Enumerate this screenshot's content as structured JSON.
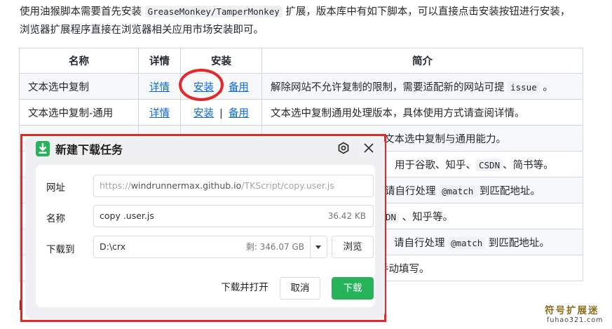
{
  "intro": {
    "text_a": "使用油猴脚本需要首先安装 ",
    "code": "GreaseMonkey/TamperMonkey",
    "text_b": " 扩展，版本库中有如下脚本，可以直接点击安装按钮进行安装，",
    "text_c": "浏览器扩展程序直接在浏览器相关应用市场安装即可。"
  },
  "table": {
    "headers": [
      "名称",
      "详情",
      "安装",
      "简介"
    ],
    "rows": [
      {
        "name": "文本选中复制",
        "detail": "详情",
        "install": "安装",
        "sep": "|",
        "backup": "备用",
        "desc_a": "解除网站不允许复制的限制，需要适配新的网站可提 ",
        "desc_code": "issue",
        "desc_b": " 。"
      },
      {
        "name": "文本选中复制-通用",
        "detail": "详情",
        "install": "安装",
        "sep": "|",
        "backup": "备用",
        "desc_a": "文本选中复制通用处理版本，具体使用方式请查阅详情。",
        "desc_code": "",
        "desc_b": ""
      },
      {
        "desc_a": "文本选中复制与通用能力。",
        "desc_code": "",
        "desc_b": ""
      },
      {
        "desc_a": "用于谷歌、知乎、",
        "desc_code": "CSDN",
        "desc_b": "、简书等。"
      },
      {
        "desc_a": "请自行处理 ",
        "desc_code": "@match",
        "desc_b": " 到匹配地址。"
      },
      {
        "desc_a": "",
        "desc_code": "DN",
        "desc_b": " 、知乎等。"
      },
      {
        "desc_a": "请自行处理 ",
        "desc_code": "@match",
        "desc_b": " 到匹配地址。"
      },
      {
        "desc_a": "手动填写。",
        "desc_code": "",
        "desc_b": ""
      }
    ]
  },
  "dialog": {
    "title": "新建下载任务",
    "url_label": "网址",
    "url_scheme": "https://",
    "url_host": "windrunnermax.github.io",
    "url_path": "/TKScript/copy.user.js",
    "name_label": "名称",
    "name_value": "copy .user.js",
    "file_size": "36.42 KB",
    "path_label": "下载到",
    "path_value": "D:\\crx",
    "free_space": "剩: 346.07 GB",
    "browse": "浏览",
    "download_open": "下载并打开",
    "cancel": "取消",
    "download": "下载"
  },
  "watermark": {
    "title": "符号扩展迷",
    "url": "fuhao321.com"
  },
  "colors": {
    "link": "#0969da",
    "highlight_red": "#e5262b",
    "download_green": "#27b35a"
  }
}
